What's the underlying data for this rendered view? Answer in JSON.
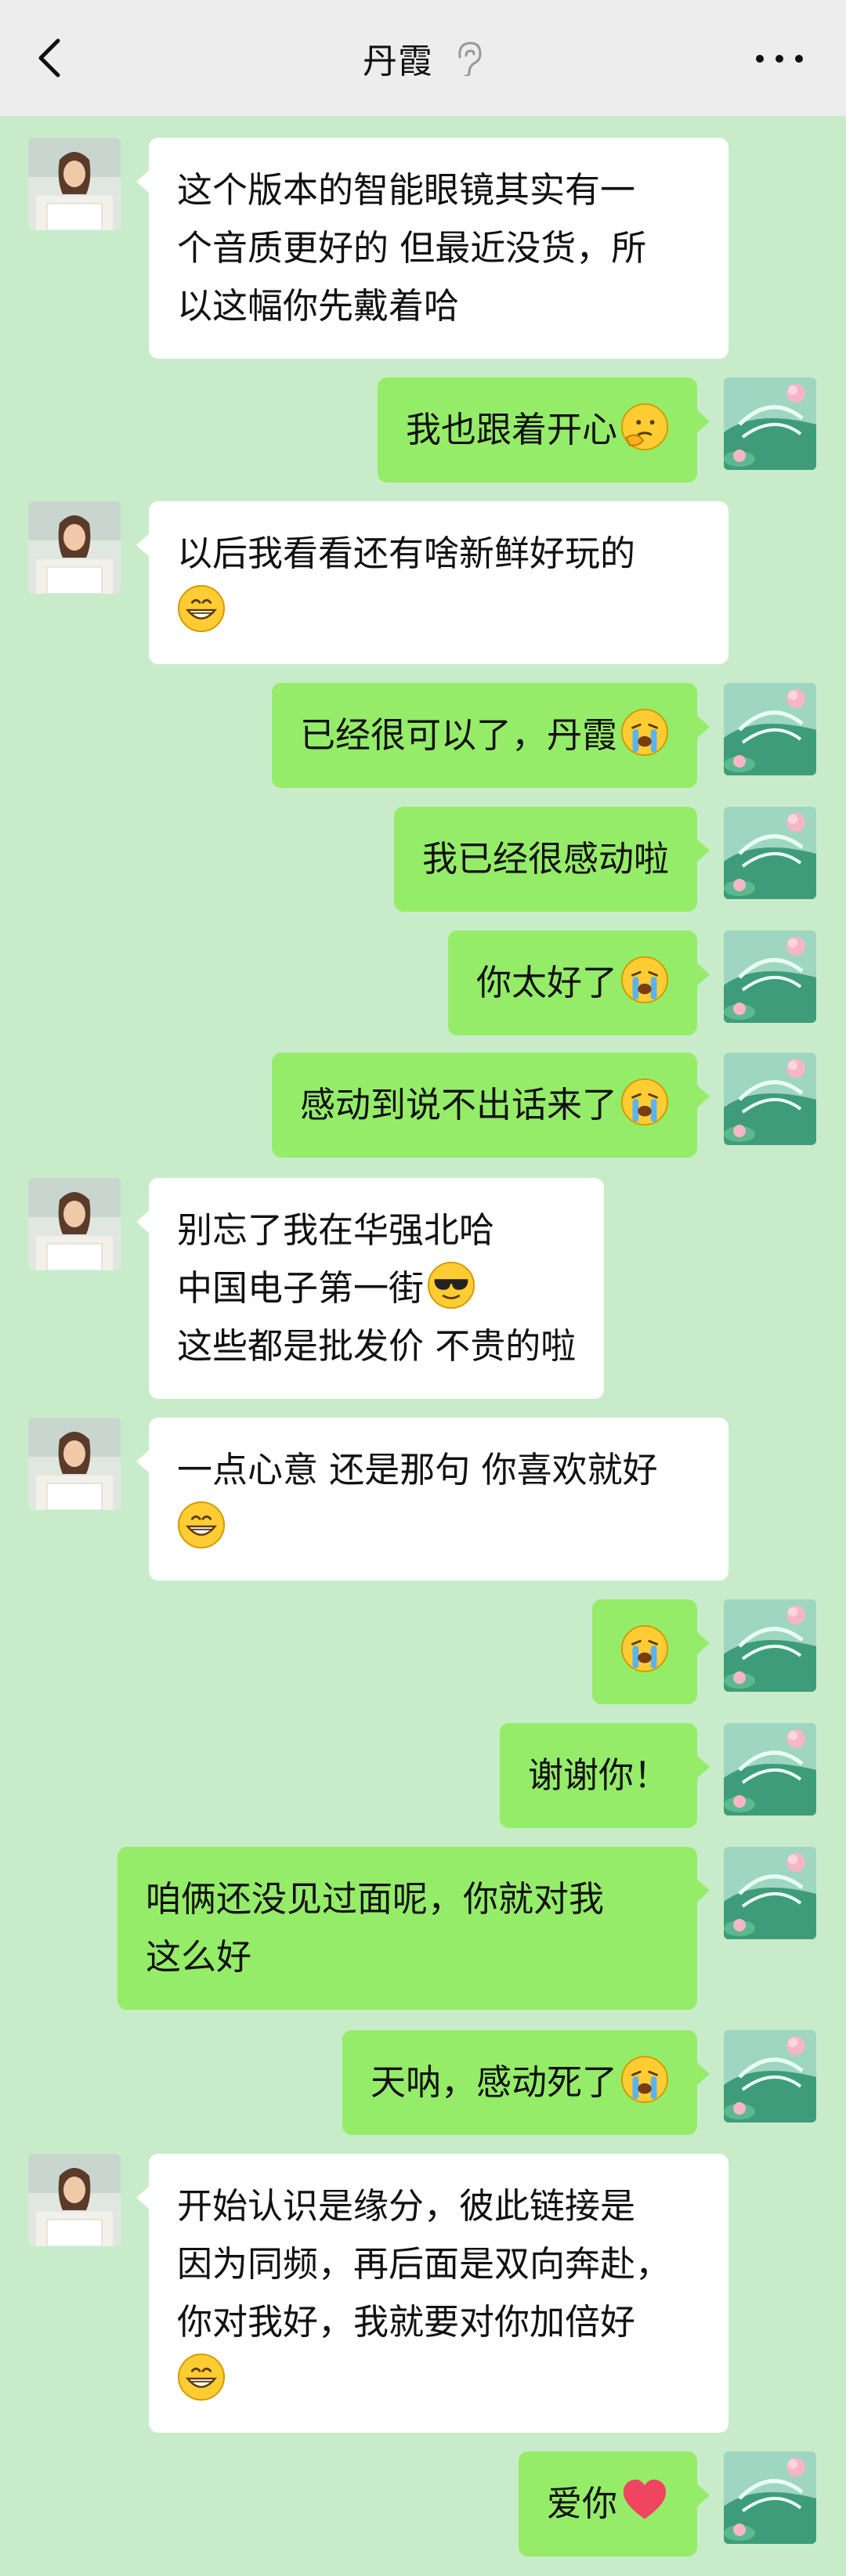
{
  "header": {
    "title": "丹霞",
    "back_icon": "chevron-left-icon",
    "mute_icon": "ear-icon",
    "more_icon": "more-dots-icon"
  },
  "colors": {
    "background": "#c8ecc9",
    "topbar": "#ededed",
    "incoming_bubble": "#ffffff",
    "outgoing_bubble": "#95ec69"
  },
  "messages": [
    {
      "from": "contact",
      "lines": [
        "这个版本的智能眼镜其实有一",
        "个音质更好的 但最近没货，所",
        "以这幅你先戴着哈"
      ]
    },
    {
      "from": "me",
      "text": "我也跟着开心",
      "emoji": "thinking-face"
    },
    {
      "from": "contact",
      "lines": [
        "以后我看看还有啥新鲜好玩的"
      ],
      "emoji": "grin"
    },
    {
      "from": "me",
      "text": "已经很可以了，丹霞",
      "emoji": "crying"
    },
    {
      "from": "me",
      "text": "我已经很感动啦"
    },
    {
      "from": "me",
      "text": "你太好了",
      "emoji": "crying"
    },
    {
      "from": "me",
      "text": "感动到说不出话来了",
      "emoji": "crying"
    },
    {
      "from": "contact",
      "lines": [
        "别忘了我在华强北哈",
        "中国电子第一街",
        "这些都是批发价 不贵的啦"
      ],
      "emoji_line2": "sunglasses"
    },
    {
      "from": "contact",
      "lines": [
        "一点心意 还是那句 你喜欢就好"
      ],
      "emoji": "grin"
    },
    {
      "from": "me",
      "text": "",
      "emoji": "crying"
    },
    {
      "from": "me",
      "text": "谢谢你！"
    },
    {
      "from": "me",
      "lines": [
        "咱俩还没见过面呢，你就对我",
        "这么好"
      ]
    },
    {
      "from": "me",
      "text": "天呐，感动死了",
      "emoji": "crying"
    },
    {
      "from": "contact",
      "lines": [
        "开始认识是缘分，彼此链接是",
        "因为同频，再后面是双向奔赴，",
        "你对我好，我就要对你加倍好"
      ],
      "emoji": "grin"
    },
    {
      "from": "me",
      "text": "爱你",
      "emoji": "heart"
    }
  ]
}
